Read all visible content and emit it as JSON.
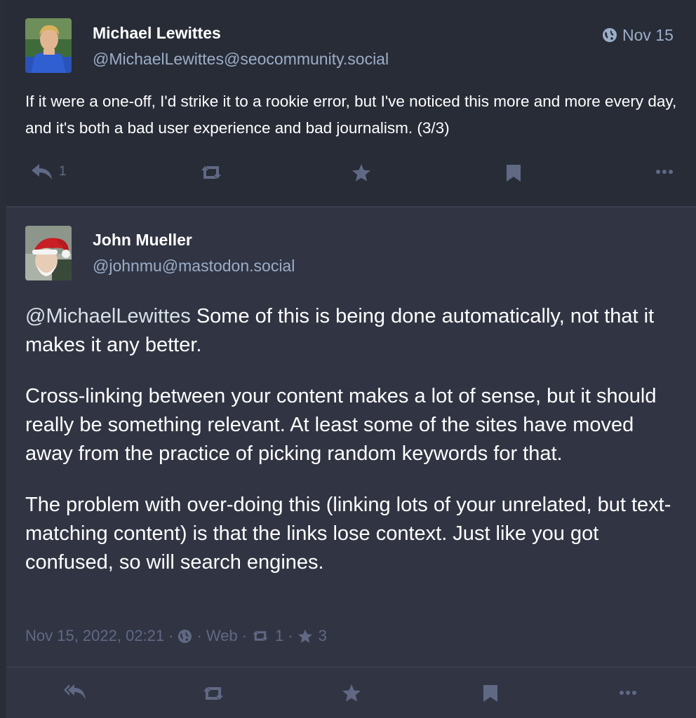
{
  "status1": {
    "display_name": "Michael Lewittes",
    "account": "@MichaelLewittes@seocommunity.social",
    "timestamp": "Nov 15",
    "visibility_icon": "globe-icon",
    "content": "If it were a one-off, I'd strike it to a rookie error, but I've noticed this more and more every day, and it's both a bad user experience and bad journalism.  (3/3)",
    "actions": {
      "reply_count": "1",
      "reply_icon": "reply-icon",
      "boost_icon": "retweet-icon",
      "favourite_icon": "star-icon",
      "bookmark_icon": "bookmark-icon",
      "more_icon": "ellipsis-icon"
    }
  },
  "status2": {
    "display_name": "John Mueller",
    "account": "@johnmu@mastodon.social",
    "mention": "@MichaelLewittes",
    "paragraphs": [
      " Some of this is being done automatically, not that it makes it any better.",
      "Cross-linking between your content makes a lot of sense, but it should really be something relevant. At least some of the sites have moved away from the practice of picking random keywords for that.",
      "The problem with over-doing this (linking lots of your unrelated, but text-matching content) is that the links lose context. Just like you got confused, so will search engines."
    ],
    "meta": {
      "datetime": "Nov 15, 2022, 02:21",
      "separator": "·",
      "application": "Web",
      "boost_count": "1",
      "favourite_count": "3"
    },
    "actions": {
      "reply_icon": "reply-all-icon",
      "boost_icon": "retweet-icon",
      "favourite_icon": "star-icon",
      "bookmark_icon": "bookmark-icon",
      "more_icon": "ellipsis-icon"
    }
  },
  "colors": {
    "background_status1": "#282c37",
    "background_status2": "#313543",
    "secondary_text": "#9baec8",
    "muted": "#606984"
  }
}
